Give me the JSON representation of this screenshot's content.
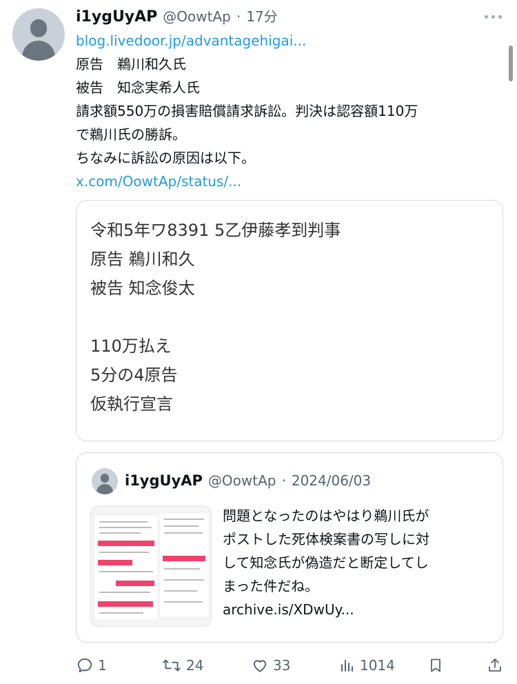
{
  "tweet": {
    "author_name": "i1ygUyAP",
    "author_handle": "@OowtAp",
    "separator": "·",
    "time": "17分",
    "lines": [
      {
        "text": "blog.livedoor.jp/advantagehigai...",
        "link": true
      },
      {
        "text": "原告　鵜川和久氏",
        "link": false
      },
      {
        "text": "被告　知念実希人氏",
        "link": false
      },
      {
        "text": "請求額550万の損害賠償請求訴訟。判決は認容額110万",
        "link": false
      },
      {
        "text": "で鵜川氏の勝訴。",
        "link": false
      },
      {
        "text": "ちなみに訴訟の原因は以下。",
        "link": false
      },
      {
        "text": "x.com/OowtAp/status/...",
        "link": true
      }
    ],
    "image_lines": [
      "令和5年ワ8391 5乙伊藤孝到判事",
      "原告  鵜川和久",
      "被告  知念俊太",
      "",
      "110万払え",
      "5分の4原告",
      "仮執行宣言"
    ]
  },
  "quote": {
    "author_name": "i1ygUyAP",
    "author_handle": "@OowtAp",
    "separator": "·",
    "date": "2024/06/03",
    "lines": [
      "問題となったのはやはり鵜川氏が",
      "ポストした死体検案書の写しに対",
      "して知念氏が偽造だと断定してし",
      "まった件だね。",
      "archive.is/XDwUy..."
    ]
  },
  "actions": {
    "reply": {
      "icon": "reply-icon",
      "count": "1"
    },
    "retweet": {
      "icon": "retweet-icon",
      "count": "24"
    },
    "like": {
      "icon": "heart-icon",
      "count": "33"
    },
    "views": {
      "icon": "views-icon",
      "count": "1014"
    },
    "bookmark": {
      "icon": "bookmark-icon"
    },
    "share": {
      "icon": "share-icon"
    }
  },
  "colors": {
    "link": "#1d9bf0",
    "muted": "#536471",
    "border": "#d5dadf"
  }
}
